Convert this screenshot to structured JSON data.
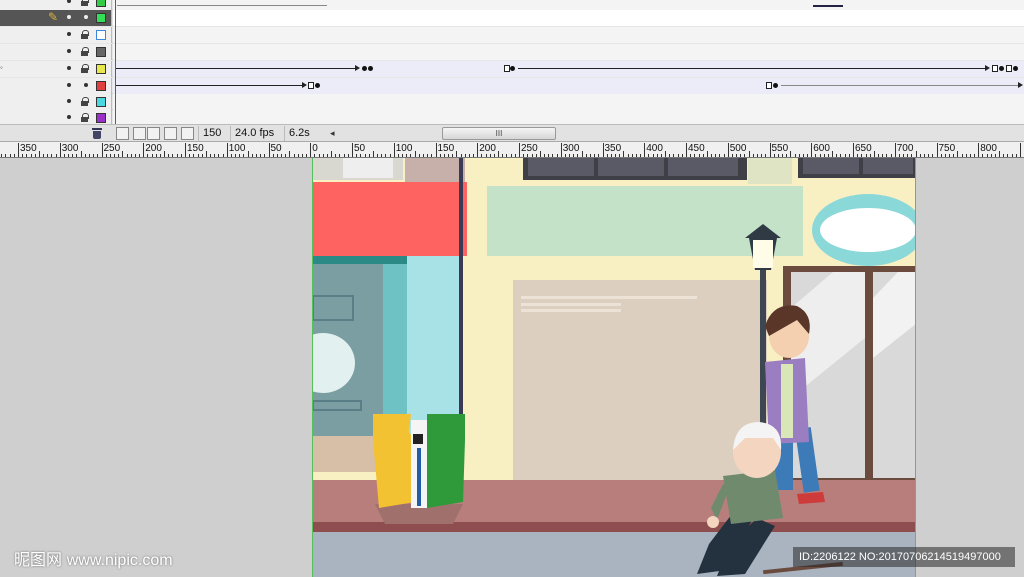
{
  "timeline": {
    "layers": [
      {
        "color": "#33cc44"
      },
      {
        "color": "#33dd55"
      },
      {
        "color": "#3b87e0"
      },
      {
        "color": "#666666"
      },
      {
        "color": "#e8e84a"
      },
      {
        "color": "#e04040"
      },
      {
        "color": "#4ad8e0"
      },
      {
        "color": "#9b30c8"
      }
    ],
    "frame_rate": "24.0 fps",
    "current_frame": "150",
    "elapsed_time": "6.2s",
    "scrollbar_grip": "III"
  },
  "ruler": {
    "labels": [
      "350",
      "300",
      "250",
      "200",
      "150",
      "100",
      "50",
      "0",
      "50",
      "100",
      "150",
      "200",
      "250",
      "300",
      "350",
      "400",
      "450",
      "500",
      "550",
      "600",
      "650",
      "700",
      "750",
      "800"
    ]
  },
  "watermark": {
    "logo": "昵图网",
    "url": "www.nipic.com",
    "id_text": "ID:2206122 NO:20170706214519497000"
  },
  "colors": {
    "stage_border": "#56c15a",
    "playhead": "#dd2233"
  }
}
